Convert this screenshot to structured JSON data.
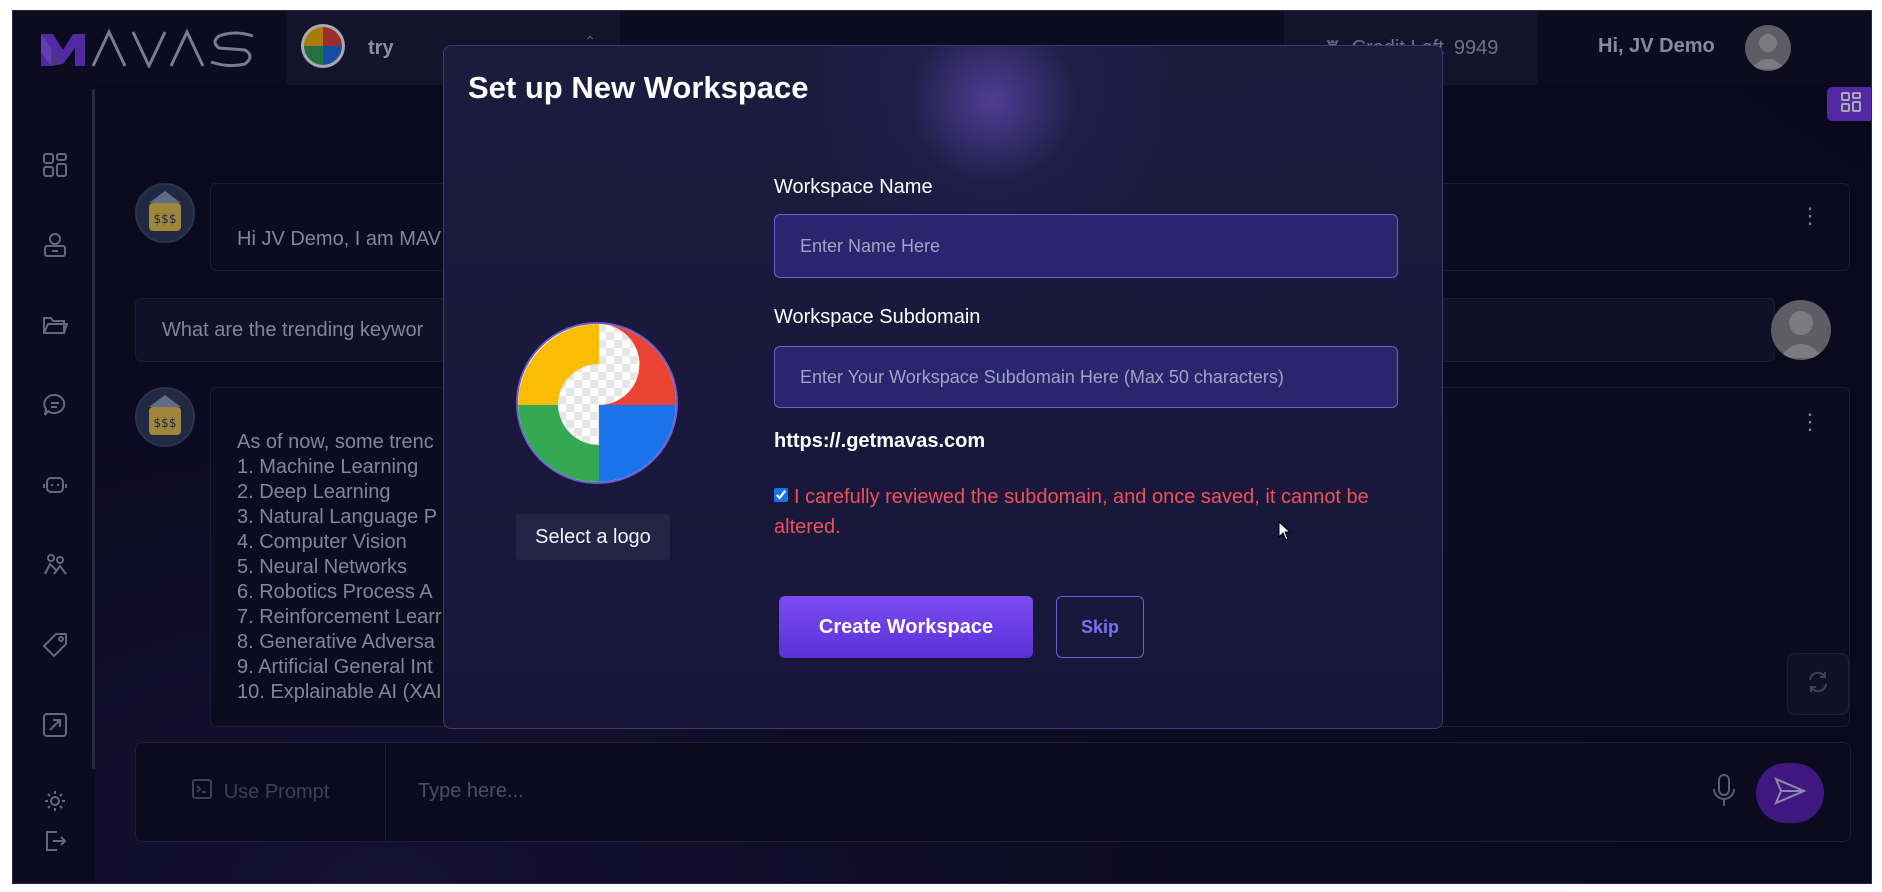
{
  "app": {
    "brand": "MAVAS",
    "brand_color": "#7c3aed"
  },
  "topbar": {
    "workspace_name": "try",
    "credits_label": "Credit Left",
    "credits_value": "9949",
    "greeting": "Hi, JV Demo"
  },
  "sidebar": {
    "items": [
      {
        "icon": "dashboard-icon"
      },
      {
        "icon": "agent-icon"
      },
      {
        "icon": "folder-icon"
      },
      {
        "icon": "chat-icon"
      },
      {
        "icon": "bot-icon"
      },
      {
        "icon": "team-icon"
      },
      {
        "icon": "tag-icon"
      },
      {
        "icon": "share-icon"
      },
      {
        "icon": "settings-icon"
      },
      {
        "icon": "logout-icon"
      }
    ]
  },
  "chat": {
    "greeting_message": "Hi JV Demo, I am MAV",
    "user_question": "What are the trending keywor",
    "answer_intro": "As of now, some trenc",
    "answer_items": [
      "1. Machine Learning",
      "2. Deep Learning",
      "3. Natural Language P",
      "4. Computer Vision",
      "5. Neural Networks",
      "6. Robotics Process A",
      "7. Reinforcement Learr",
      "8. Generative Adversa",
      "9. Artificial General Int",
      "10. Explainable AI (XAI"
    ]
  },
  "composer": {
    "use_prompt_label": "Use Prompt",
    "placeholder": "Type here..."
  },
  "modal": {
    "title": "Set up New Workspace",
    "select_logo_label": "Select a logo",
    "name_label": "Workspace Name",
    "name_placeholder": "Enter Name Here",
    "subdomain_label": "Workspace Subdomain",
    "subdomain_placeholder": "Enter Your Workspace Subdomain Here (Max 50 characters)",
    "url_preview": "https://.getmavas.com",
    "confirm_text": "I carefully reviewed the subdomain, and once saved, it cannot be altered.",
    "confirm_checked": true,
    "create_label": "Create Workspace",
    "skip_label": "Skip"
  },
  "colors": {
    "background": "#0d0b22",
    "modal": "#1b1a3d",
    "input": "#29266e",
    "warning": "#f0505a",
    "primary_button": "#6a3fe6"
  }
}
